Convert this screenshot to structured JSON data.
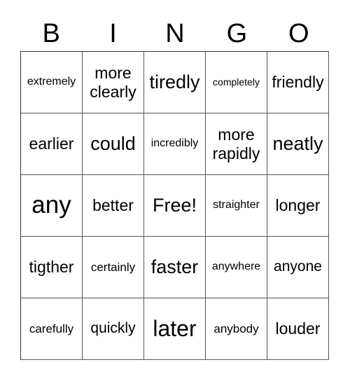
{
  "header": {
    "letters": [
      "B",
      "I",
      "N",
      "G",
      "O"
    ]
  },
  "board": {
    "rows": [
      [
        "extremely",
        "more clearly",
        "tiredly",
        "completely",
        "friendly"
      ],
      [
        "earlier",
        "could",
        "incredibly",
        "more rapidly",
        "neatly"
      ],
      [
        "any",
        "better",
        "Free!",
        "straighter",
        "longer"
      ],
      [
        "tigther",
        "certainly",
        "faster",
        "anywhere",
        "anyone"
      ],
      [
        "carefully",
        "quickly",
        "later",
        "anybody",
        "louder"
      ]
    ]
  }
}
